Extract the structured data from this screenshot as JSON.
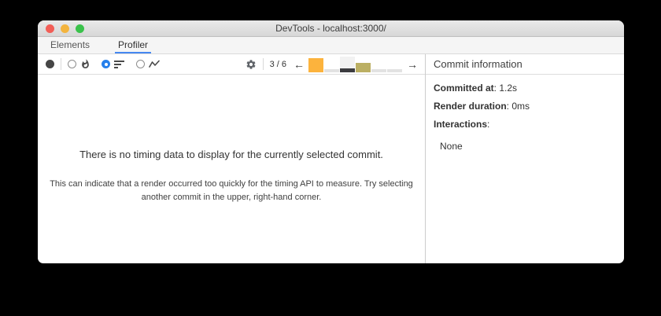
{
  "window": {
    "title": "DevTools - localhost:3000/"
  },
  "traffic_lights": [
    {
      "name": "close",
      "color": "#f25e57"
    },
    {
      "name": "minimize",
      "color": "#f3b43e"
    },
    {
      "name": "zoom",
      "color": "#3ac24b"
    }
  ],
  "tabs": [
    {
      "label": "Elements",
      "active": false
    },
    {
      "label": "Profiler",
      "active": true
    }
  ],
  "toolbar": {
    "record_icon": "record-icon",
    "views": [
      {
        "name": "flamegraph",
        "icon": "flame-icon",
        "selected": false
      },
      {
        "name": "ranked",
        "icon": "ranked-chart-icon",
        "selected": true
      },
      {
        "name": "interactions",
        "icon": "interactions-icon",
        "selected": false
      }
    ],
    "settings_icon": "gear-icon",
    "commit_selector": {
      "label": "3 / 6",
      "prev_icon": "←",
      "next_icon": "→",
      "commits": [
        {
          "height": 18,
          "color": "#fcb33d",
          "selected": false
        },
        {
          "height": 4,
          "color": "#e2e2e2",
          "selected": false
        },
        {
          "height": 5,
          "color": "#3c3c40",
          "selected": true
        },
        {
          "height": 12,
          "color": "#bbaf63",
          "selected": false
        },
        {
          "height": 4,
          "color": "#e2e2e2",
          "selected": false
        },
        {
          "height": 4,
          "color": "#e2e2e2",
          "selected": false
        }
      ],
      "selected_bg": "#f2f2f2"
    }
  },
  "right_panel": {
    "header": "Commit information",
    "rows": [
      {
        "label": "Committed at",
        "value": "1.2s"
      },
      {
        "label": "Render duration",
        "value": "0ms"
      },
      {
        "label": "Interactions",
        "value": ""
      }
    ],
    "interactions_empty": "None"
  },
  "empty_state": {
    "title": "There is no timing data to display for the currently selected commit.",
    "description": "This can indicate that a render occurred too quickly for the timing API to measure. Try selecting another commit in the upper, right-hand corner."
  },
  "colors": {
    "tab_accent": "#4688f1",
    "radio_selected": "#2680eb",
    "bar_orange": "#fcb33d",
    "bar_olive": "#bbaf63",
    "bar_gray": "#e2e2e2",
    "bar_selected_dark": "#3c3c40"
  }
}
